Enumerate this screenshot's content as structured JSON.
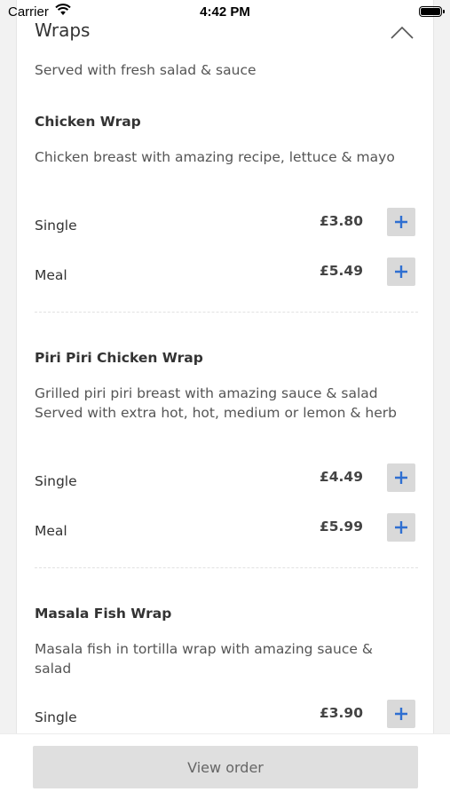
{
  "status_bar": {
    "carrier": "Carrier",
    "time": "4:42 PM"
  },
  "section": {
    "title": "Wraps",
    "subtitle": "Served with fresh salad & sauce"
  },
  "items": [
    {
      "name": "Chicken Wrap",
      "description": "Chicken breast with amazing recipe, lettuce & mayo",
      "options": [
        {
          "label": "Single",
          "price": "£3.80"
        },
        {
          "label": "Meal",
          "price": "£5.49"
        }
      ]
    },
    {
      "name": "Piri Piri Chicken Wrap",
      "description": "Grilled piri piri breast with amazing sauce & salad Served with extra hot, hot, medium or lemon & herb",
      "options": [
        {
          "label": "Single",
          "price": "£4.49"
        },
        {
          "label": "Meal",
          "price": "£5.99"
        }
      ]
    },
    {
      "name": "Masala Fish Wrap",
      "description": "Masala fish in tortilla wrap with amazing sauce & salad",
      "options": [
        {
          "label": "Single",
          "price": "£3.90"
        }
      ]
    }
  ],
  "footer": {
    "view_order_label": "View order"
  },
  "colors": {
    "accent": "#2f6fd1",
    "button_bg": "#d9d9d9"
  },
  "icons": [
    "wifi-icon",
    "battery-icon",
    "chevron-up-icon",
    "plus-icon"
  ]
}
